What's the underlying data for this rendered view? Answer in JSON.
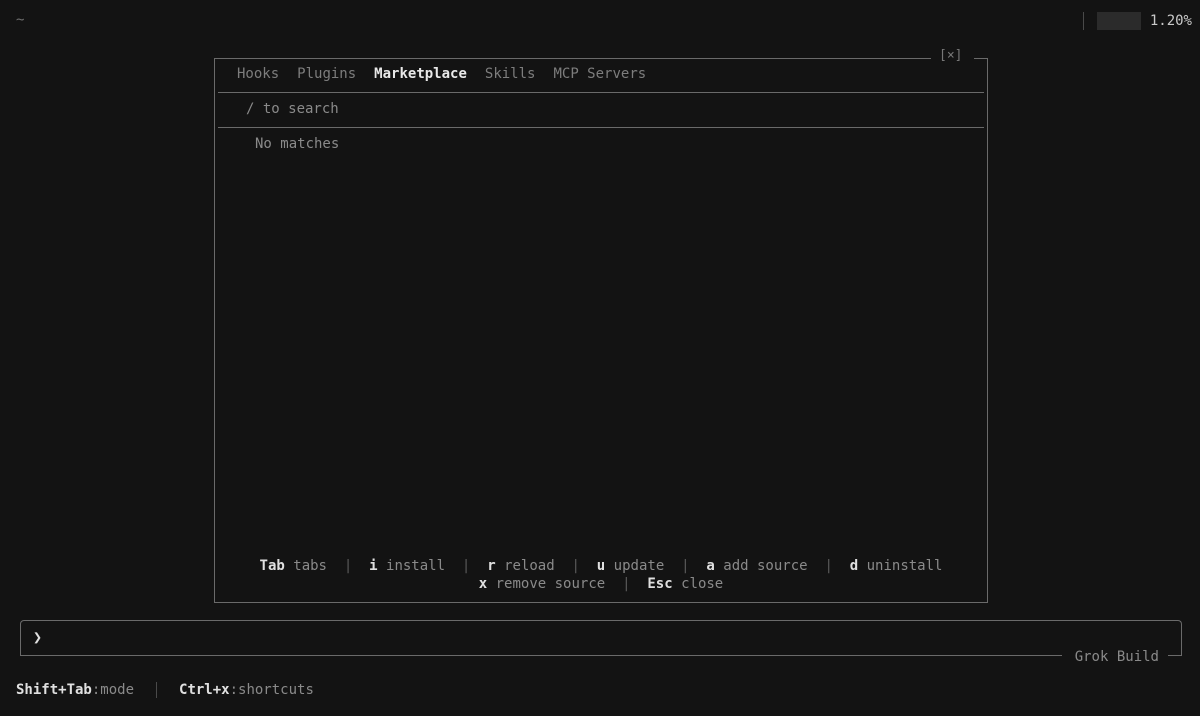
{
  "cwd": "~",
  "usage": {
    "percent_label": "1.20%"
  },
  "dialog": {
    "close_label": "[×]",
    "tabs": [
      {
        "label": "Hooks",
        "active": false
      },
      {
        "label": "Plugins",
        "active": false
      },
      {
        "label": "Marketplace",
        "active": true
      },
      {
        "label": "Skills",
        "active": false
      },
      {
        "label": "MCP Servers",
        "active": false
      }
    ],
    "search_placeholder": "/ to search",
    "empty_text": "No matches",
    "shortcuts": [
      {
        "key": "Tab",
        "desc": "tabs"
      },
      {
        "key": "i",
        "desc": "install"
      },
      {
        "key": "r",
        "desc": "reload"
      },
      {
        "key": "u",
        "desc": "update"
      },
      {
        "key": "a",
        "desc": "add source"
      },
      {
        "key": "d",
        "desc": "uninstall"
      },
      {
        "key": "x",
        "desc": "remove source"
      },
      {
        "key": "Esc",
        "desc": "close"
      }
    ]
  },
  "prompt": {
    "chevron": "❯",
    "label": "Grok Build"
  },
  "statusbar": [
    {
      "key": "Shift+Tab",
      "desc": ":mode"
    },
    {
      "key": "Ctrl+x",
      "desc": ":shortcuts"
    }
  ],
  "colors": {
    "background": "#131313",
    "border": "#6a6a6a",
    "active_text": "#e8e8e8"
  }
}
